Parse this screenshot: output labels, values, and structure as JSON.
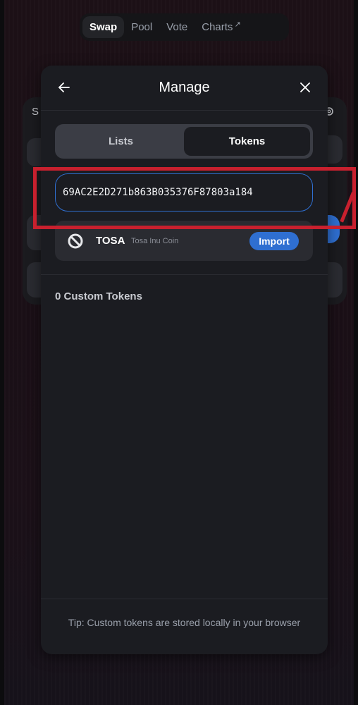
{
  "nav": {
    "items": [
      {
        "label": "Swap",
        "active": true
      },
      {
        "label": "Pool",
        "active": false
      },
      {
        "label": "Vote",
        "active": false
      },
      {
        "label": "Charts",
        "active": false,
        "external_arrow": "↗"
      }
    ]
  },
  "background_card": {
    "partial_title": "S",
    "icon": "gear-icon"
  },
  "modal": {
    "title": "Manage",
    "back_icon": "arrow-left-icon",
    "close_icon": "close-icon",
    "tabs": [
      {
        "label": "Lists",
        "active": false
      },
      {
        "label": "Tokens",
        "active": true
      }
    ],
    "address_input": {
      "value": "69AC2E2D271b863B035376F87803a184"
    },
    "search_result": {
      "icon": "blocked-icon",
      "symbol": "TOSA",
      "name": "Tosa Inu Coin",
      "action_label": "Import"
    },
    "custom_tokens_label": "0 Custom Tokens",
    "tip": "Tip: Custom tokens are stored locally in your browser"
  },
  "colors": {
    "accent_blue": "#2f6fd1",
    "highlight_red": "#c8202e",
    "modal_bg": "#1b1c21"
  }
}
